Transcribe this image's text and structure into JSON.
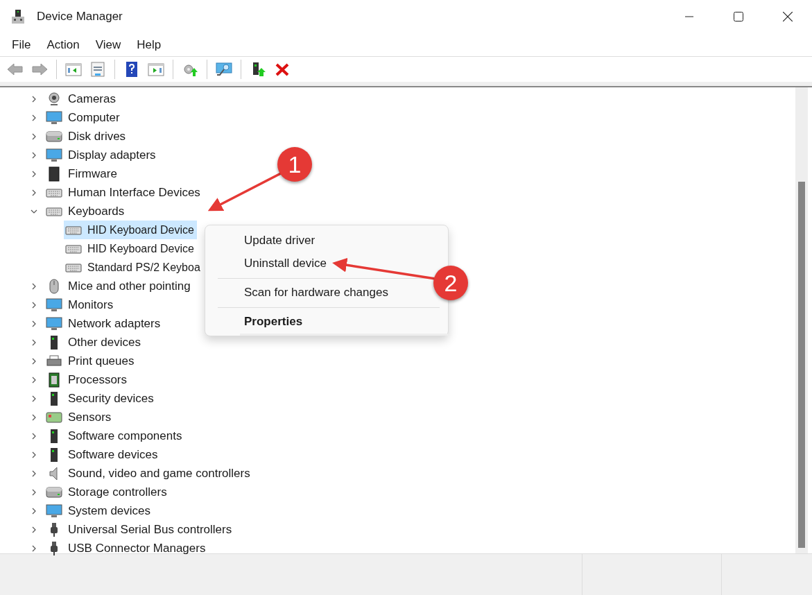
{
  "window": {
    "title": "Device Manager"
  },
  "menu_bar": [
    "File",
    "Action",
    "View",
    "Help"
  ],
  "toolbar": [
    {
      "kind": "back",
      "disabled": true
    },
    {
      "kind": "forward",
      "disabled": true
    },
    {
      "kind": "tree-pane",
      "disabled": false
    },
    {
      "kind": "properties",
      "disabled": false
    },
    {
      "kind": "help",
      "disabled": false
    },
    {
      "kind": "action-pane",
      "disabled": false
    },
    {
      "kind": "update",
      "disabled": false
    },
    {
      "kind": "scan",
      "disabled": false
    },
    {
      "kind": "enable",
      "disabled": false
    },
    {
      "kind": "uninstall",
      "disabled": false
    }
  ],
  "tree": [
    {
      "label": "Cameras",
      "kind": "camera",
      "expanded": false,
      "selected": false
    },
    {
      "label": "Computer",
      "kind": "monitor",
      "expanded": false,
      "selected": false
    },
    {
      "label": "Disk drives",
      "kind": "disk",
      "expanded": false,
      "selected": false
    },
    {
      "label": "Display adapters",
      "kind": "monitor",
      "expanded": false,
      "selected": false
    },
    {
      "label": "Firmware",
      "kind": "chip",
      "expanded": false,
      "selected": false
    },
    {
      "label": "Human Interface Devices",
      "kind": "keyboard",
      "expanded": false,
      "selected": false
    },
    {
      "label": "Keyboards",
      "kind": "keyboard",
      "expanded": true,
      "selected": false,
      "children": [
        {
          "label": "HID Keyboard Device",
          "kind": "keyboard",
          "selected": true
        },
        {
          "label": "HID Keyboard Device",
          "kind": "keyboard",
          "selected": false
        },
        {
          "label": "Standard PS/2 Keyboa",
          "kind": "keyboard",
          "selected": false
        }
      ]
    },
    {
      "label": "Mice and other pointing",
      "kind": "mouse",
      "expanded": false,
      "selected": false
    },
    {
      "label": "Monitors",
      "kind": "monitor",
      "expanded": false,
      "selected": false
    },
    {
      "label": "Network adapters",
      "kind": "monitor",
      "expanded": false,
      "selected": false
    },
    {
      "label": "Other devices",
      "kind": "tower",
      "expanded": false,
      "selected": false
    },
    {
      "label": "Print queues",
      "kind": "printer",
      "expanded": false,
      "selected": false
    },
    {
      "label": "Processors",
      "kind": "chip-green",
      "expanded": false,
      "selected": false
    },
    {
      "label": "Security devices",
      "kind": "tower",
      "expanded": false,
      "selected": false
    },
    {
      "label": "Sensors",
      "kind": "sensor",
      "expanded": false,
      "selected": false
    },
    {
      "label": "Software components",
      "kind": "tower",
      "expanded": false,
      "selected": false
    },
    {
      "label": "Software devices",
      "kind": "tower",
      "expanded": false,
      "selected": false
    },
    {
      "label": "Sound, video and game controllers",
      "kind": "speaker",
      "expanded": false,
      "selected": false
    },
    {
      "label": "Storage controllers",
      "kind": "disk",
      "expanded": false,
      "selected": false
    },
    {
      "label": "System devices",
      "kind": "monitor",
      "expanded": false,
      "selected": false
    },
    {
      "label": "Universal Serial Bus controllers",
      "kind": "usb",
      "expanded": false,
      "selected": false
    },
    {
      "label": "USB Connector Managers",
      "kind": "usb",
      "expanded": false,
      "selected": false
    }
  ],
  "context_menu": [
    {
      "kind": "item",
      "label": "Update driver",
      "default": false
    },
    {
      "kind": "item",
      "label": "Uninstall device",
      "default": false
    },
    {
      "kind": "separator"
    },
    {
      "kind": "item",
      "label": "Scan for hardware changes",
      "default": false
    },
    {
      "kind": "separator"
    },
    {
      "kind": "item",
      "label": "Properties",
      "default": true
    }
  ],
  "annotations": [
    {
      "number": "1"
    },
    {
      "number": "2"
    }
  ]
}
